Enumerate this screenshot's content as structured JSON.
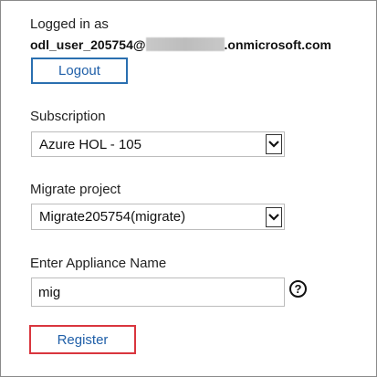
{
  "session": {
    "logged_in_label": "Logged in as",
    "user_prefix": "odl_user_205754@",
    "user_suffix": ".onmicrosoft.com",
    "logout_label": "Logout"
  },
  "subscription": {
    "label": "Subscription",
    "selected": "Azure HOL - 105"
  },
  "migrate_project": {
    "label": "Migrate project",
    "selected": "Migrate205754(migrate)"
  },
  "appliance": {
    "label": "Enter Appliance Name",
    "value": "mig",
    "help_icon": "question-mark-circle",
    "help_glyph": "?"
  },
  "register": {
    "label": "Register",
    "highlight_color": "#d9363e"
  },
  "colors": {
    "accent": "#1f5fa8",
    "button_border": "#2a6fb0"
  }
}
